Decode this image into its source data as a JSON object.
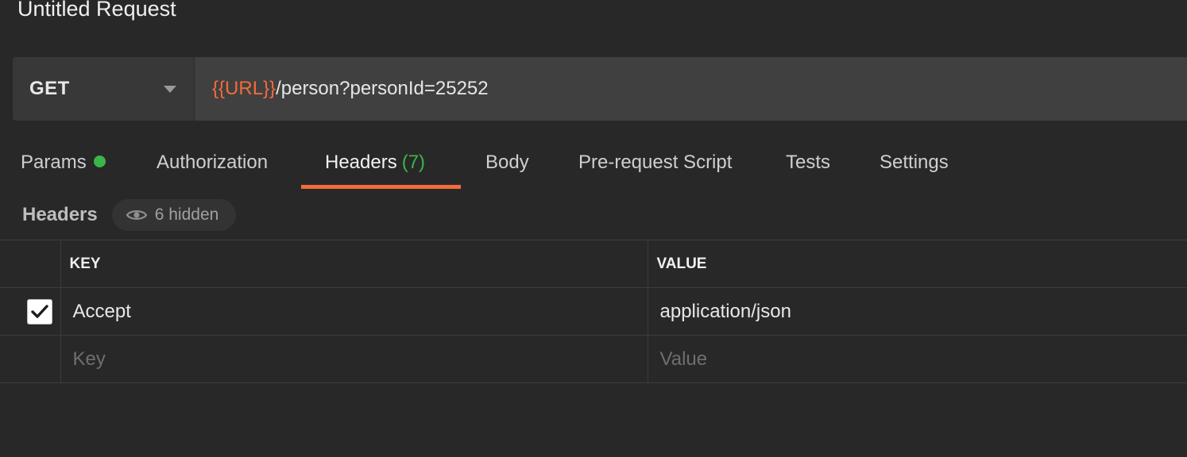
{
  "request": {
    "title": "Untitled Request",
    "method": "GET",
    "url_variable": "{{URL}}",
    "url_path": "/person?personId=25252"
  },
  "tabs": [
    {
      "label": "Params",
      "indicator": "green-dot"
    },
    {
      "label": "Authorization"
    },
    {
      "label": "Headers",
      "count": "(7)",
      "active": true
    },
    {
      "label": "Body"
    },
    {
      "label": "Pre-request Script"
    },
    {
      "label": "Tests"
    },
    {
      "label": "Settings"
    }
  ],
  "headers_section": {
    "label": "Headers",
    "hidden_text": "6 hidden",
    "hidden_icon": "eye-icon"
  },
  "table": {
    "columns": [
      "KEY",
      "VALUE"
    ],
    "rows": [
      {
        "checked": true,
        "key": "Accept",
        "value": "application/json"
      }
    ],
    "new_row": {
      "key_placeholder": "Key",
      "value_placeholder": "Value"
    }
  },
  "colors": {
    "background": "#282828",
    "accent": "#f26b3a",
    "success": "#3bb44a"
  }
}
